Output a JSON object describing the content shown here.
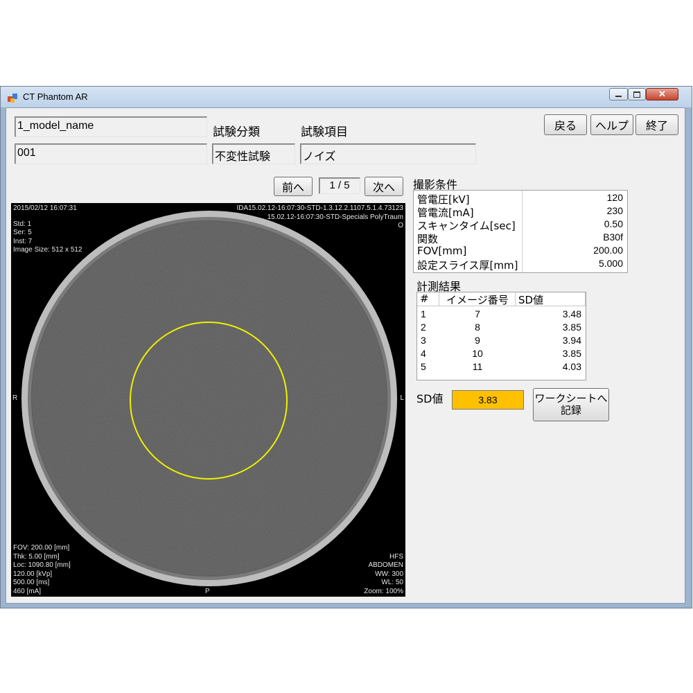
{
  "window": {
    "title": "CT Phantom AR",
    "controls": [
      "minimize",
      "maximize",
      "close"
    ]
  },
  "fields": {
    "model_name": "1_model_name",
    "id": "001",
    "category_label": "試験分類",
    "category_value": "不変性試験",
    "item_label": "試験項目",
    "item_value": "ノイズ"
  },
  "buttons": {
    "back": "戻る",
    "help": "ヘルプ",
    "exit": "終了",
    "prev": "前へ",
    "next": "次へ",
    "record": "ワークシートへ\n記録"
  },
  "pager": {
    "text": "1 / 5"
  },
  "viewer": {
    "top_left": [
      "2015/02/12 16:07:31",
      "",
      "Std: 1",
      "Ser: 5",
      "Inst: 7",
      "Image Size: 512 x 512"
    ],
    "top_right": [
      "IDA15.02.12-16:07:30-STD-1.3.12.2.1107.5.1.4.73123",
      "15.02.12-16:07:30-STD-Specials PolyTraum",
      "O"
    ],
    "left_marker": "R",
    "right_marker": "L",
    "bottom_marker": "P",
    "bottom_left": [
      "FOV: 200.00 [mm]",
      "Thk: 5.00 [mm]",
      "Loc: 1090.80 [mm]",
      "120.00 [kVp]",
      "500.00 [ms]",
      "460 [mA]"
    ],
    "bottom_right": [
      "HFS",
      "ABDOMEN",
      "WW: 300",
      "WL: 50",
      "Zoom: 100%"
    ],
    "roi_color": "#f0f000"
  },
  "conditions": {
    "title": "撮影条件",
    "rows": [
      {
        "key": "管電圧[kV]",
        "value": "120"
      },
      {
        "key": "管電流[mA]",
        "value": "230"
      },
      {
        "key": "スキャンタイム[sec]",
        "value": "0.50"
      },
      {
        "key": "関数",
        "value": "B30f"
      },
      {
        "key": "FOV[mm]",
        "value": "200.00"
      },
      {
        "key": "設定スライス厚[mm]",
        "value": "5.000"
      }
    ]
  },
  "results": {
    "title": "計測結果",
    "headers": [
      "#",
      "イメージ番号",
      "SD値"
    ],
    "rows": [
      {
        "n": "1",
        "image": "7",
        "sd": "3.48"
      },
      {
        "n": "2",
        "image": "8",
        "sd": "3.85"
      },
      {
        "n": "3",
        "image": "9",
        "sd": "3.94"
      },
      {
        "n": "4",
        "image": "10",
        "sd": "3.85"
      },
      {
        "n": "5",
        "image": "11",
        "sd": "4.03"
      }
    ]
  },
  "sd_summary": {
    "label": "SD値",
    "value": "3.83",
    "value_bg": "#ffc000"
  }
}
